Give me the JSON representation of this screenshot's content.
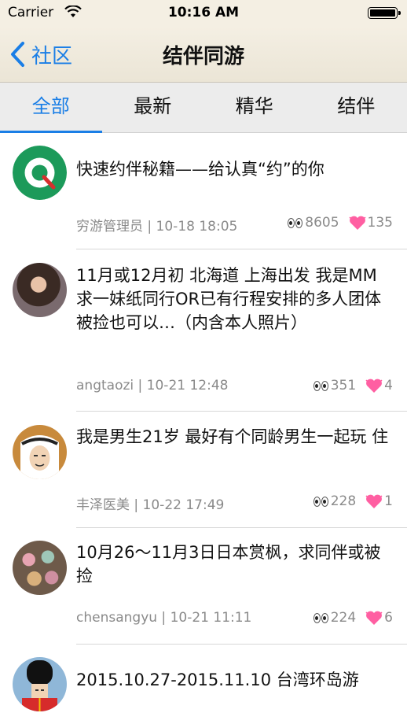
{
  "status_bar": {
    "carrier": "Carrier",
    "time": "10:16 AM"
  },
  "nav": {
    "back_label": "社区",
    "title": "结伴同游"
  },
  "tabs": [
    {
      "label": "全部",
      "active": true
    },
    {
      "label": "最新",
      "active": false
    },
    {
      "label": "精华",
      "active": false
    },
    {
      "label": "结伴",
      "active": false
    }
  ],
  "posts": [
    {
      "title": "快速约伴秘籍——给认真“约”的你",
      "author": "穷游管理员",
      "date": "10-18 18:05",
      "views": "8605",
      "likes": "135",
      "avatar": "qyer-logo"
    },
    {
      "title": "11月或12月初 北海道 上海出发 我是MM求一妹纸同行OR已有行程安排的多人团体被捡也可以…（内含本人照片）",
      "author": "angtaozi",
      "date": "10-21 12:48",
      "views": "351",
      "likes": "4",
      "avatar": "girl-photo"
    },
    {
      "title": "我是男生21岁 最好有个同龄男生一起玩 住",
      "author": "丰泽医美",
      "date": "10-22 17:49",
      "views": "228",
      "likes": "1",
      "avatar": "arab-man-illustration"
    },
    {
      "title": "10月26～11月3日日本赏枫，求同伴或被捡",
      "author": "chensangyu",
      "date": "10-21 11:11",
      "views": "224",
      "likes": "6",
      "avatar": "cakes-photo"
    },
    {
      "title": "2015.10.27-2015.11.10 台湾环岛游",
      "author": "",
      "date": "",
      "views": "",
      "likes": "",
      "avatar": "royal-guard-illustration"
    }
  ],
  "colors": {
    "accent": "#1a7ee6",
    "meta_text": "#8a8a8a",
    "heart": "#ff5fa2"
  }
}
